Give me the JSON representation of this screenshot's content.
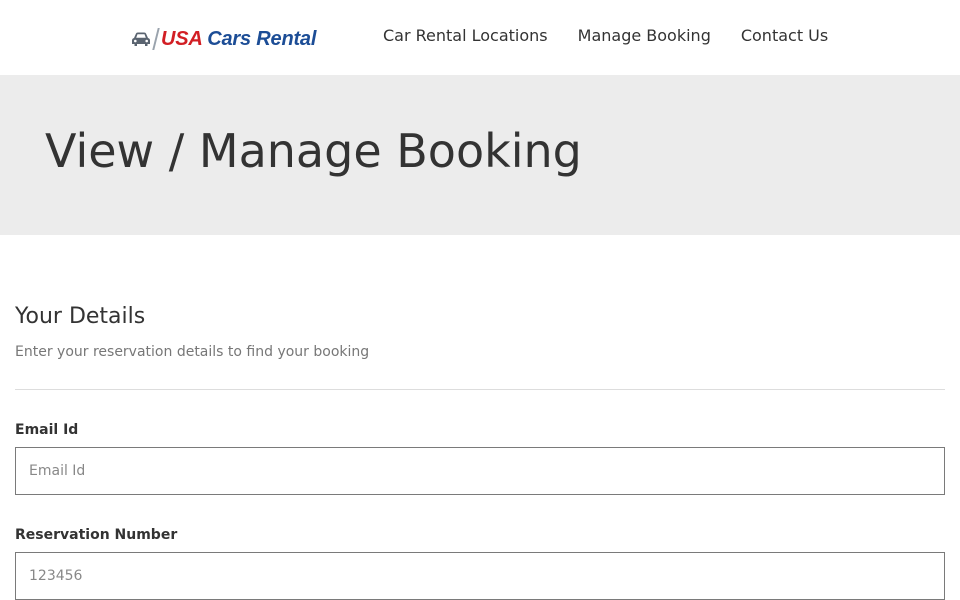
{
  "header": {
    "logo": {
      "brand_usa": "USA",
      "brand_rest": " Cars Rental",
      "icon": "car-icon"
    },
    "nav": [
      {
        "label": "Car Rental Locations"
      },
      {
        "label": "Manage Booking"
      },
      {
        "label": "Contact Us"
      }
    ]
  },
  "hero": {
    "title": "View / Manage Booking"
  },
  "form": {
    "title": "Your Details",
    "subtitle": "Enter your reservation details to find your booking",
    "email": {
      "label": "Email Id",
      "placeholder": "Email Id",
      "value": ""
    },
    "reservation": {
      "label": "Reservation Number",
      "placeholder": "123456",
      "value": ""
    }
  },
  "colors": {
    "brand_red": "#d21e24",
    "brand_blue": "#1c4d96",
    "hero_bg": "#ececec"
  }
}
